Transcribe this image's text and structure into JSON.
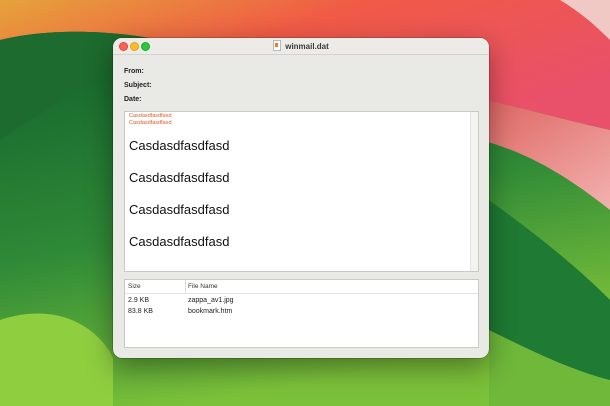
{
  "window": {
    "title": "winmail.dat"
  },
  "headers": [
    {
      "label": "From:"
    },
    {
      "label": "Subject:"
    },
    {
      "label": "Date:"
    }
  ],
  "body": {
    "small_lines": [
      "Casdasdfasdfasd",
      "Casdasdfasdfasd"
    ],
    "large_lines": [
      "Casdasdfasdfasd",
      "Casdasdfasdfasd",
      "Casdasdfasdfasd",
      "Casdasdfasdfasd"
    ]
  },
  "attachments": {
    "columns": [
      "Size",
      "File Name"
    ],
    "rows": [
      {
        "size": "2.9 KB",
        "name": "zappa_av1.jpg"
      },
      {
        "size": "83.8 KB",
        "name": "bookmark.htm"
      }
    ]
  },
  "colors": {
    "accent_red_text": "#e05a2c",
    "close": "#fe5f57",
    "minimize": "#febc2e",
    "zoom": "#28c840"
  }
}
